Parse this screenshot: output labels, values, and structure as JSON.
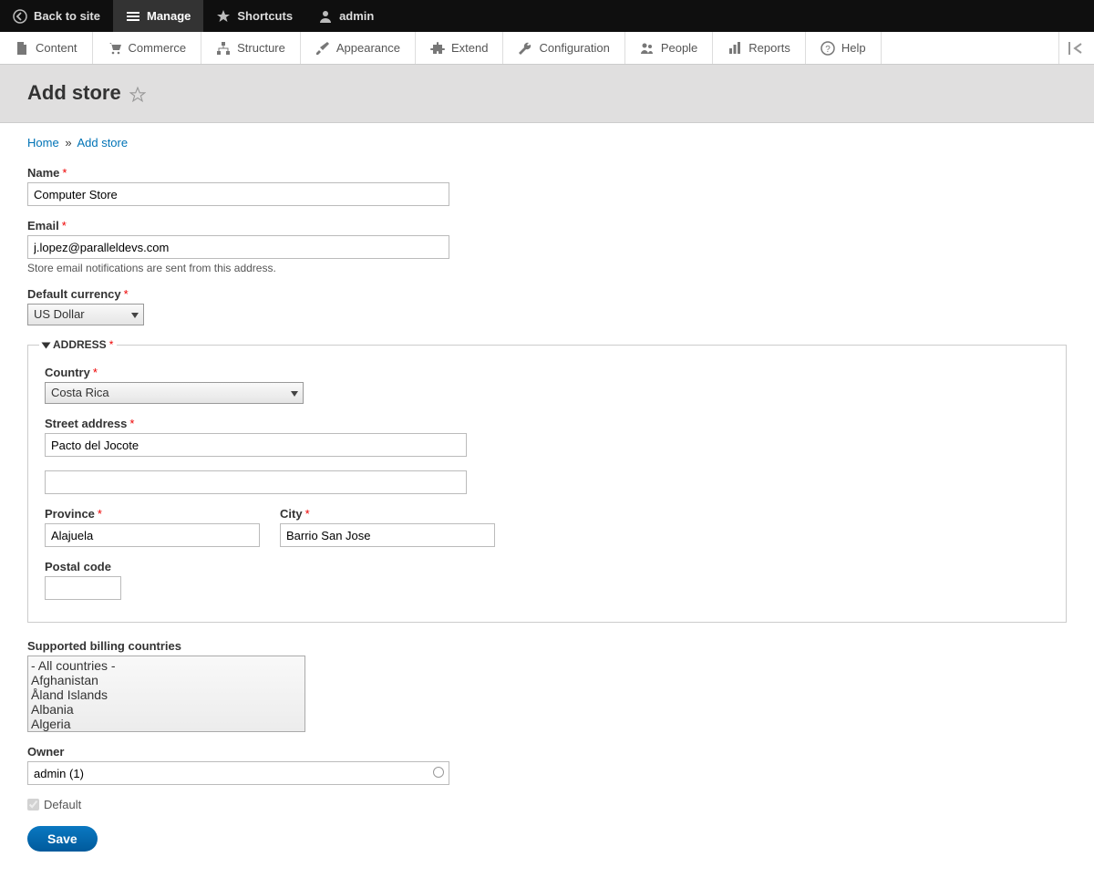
{
  "toolbar": {
    "back": "Back to site",
    "manage": "Manage",
    "shortcuts": "Shortcuts",
    "user": "admin"
  },
  "admin_tabs": {
    "content": "Content",
    "commerce": "Commerce",
    "structure": "Structure",
    "appearance": "Appearance",
    "extend": "Extend",
    "configuration": "Configuration",
    "people": "People",
    "reports": "Reports",
    "help": "Help"
  },
  "page_title": "Add store",
  "breadcrumb": {
    "home": "Home",
    "current": "Add store"
  },
  "form": {
    "name_label": "Name",
    "name_value": "Computer Store",
    "email_label": "Email",
    "email_value": "j.lopez@paralleldevs.com",
    "email_help": "Store email notifications are sent from this address.",
    "currency_label": "Default currency",
    "currency_value": "US Dollar",
    "address_legend": "ADDRESS",
    "country_label": "Country",
    "country_value": "Costa Rica",
    "street_label": "Street address",
    "street_value": "Pacto del Jocote",
    "street2_value": "",
    "province_label": "Province",
    "province_value": "Alajuela",
    "city_label": "City",
    "city_value": "Barrio San Jose",
    "postal_label": "Postal code",
    "postal_value": "",
    "billing_label": "Supported billing countries",
    "billing_options": [
      "- All countries -",
      "Afghanistan",
      "Åland Islands",
      "Albania",
      "Algeria"
    ],
    "owner_label": "Owner",
    "owner_value": "admin (1)",
    "default_label": "Default",
    "save_label": "Save"
  }
}
